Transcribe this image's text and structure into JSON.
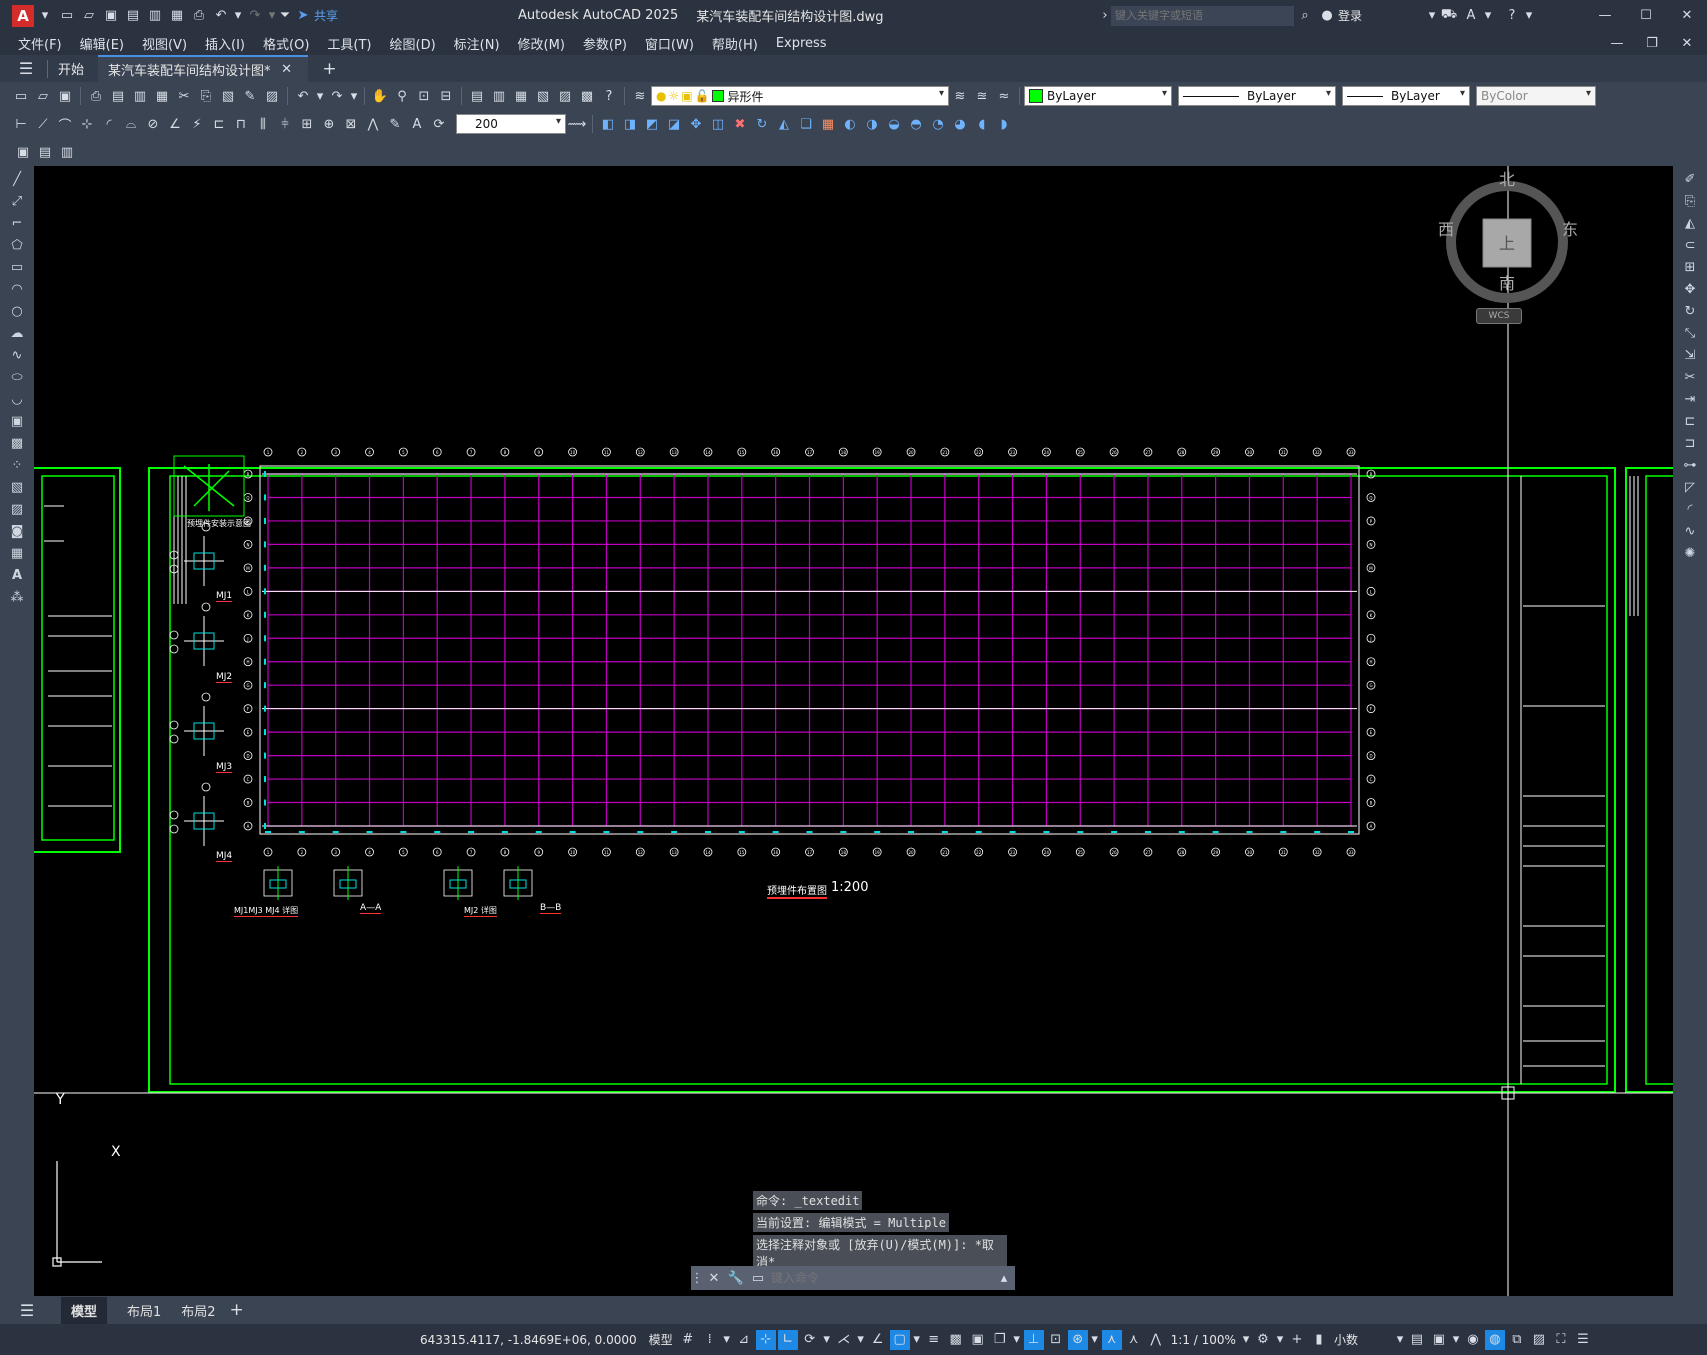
{
  "app": {
    "title": "Autodesk AutoCAD 2025",
    "document": "某汽车装配车间结构设计图.dwg",
    "share": "共享",
    "search_placeholder": "键入关键字或短语",
    "login": "登录"
  },
  "menu": [
    "文件(F)",
    "编辑(E)",
    "视图(V)",
    "插入(I)",
    "格式(O)",
    "工具(T)",
    "绘图(D)",
    "标注(N)",
    "修改(M)",
    "参数(P)",
    "窗口(W)",
    "帮助(H)",
    "Express"
  ],
  "tabs": {
    "start": "开始",
    "drawing": "某汽车装配车间结构设计图*"
  },
  "toolbar": {
    "layer": "异形件",
    "color": "ByLayer",
    "linetype": "ByLayer",
    "lineweight": "ByLayer",
    "plotstyle": "ByColor",
    "dimscale": "200"
  },
  "viewcube": {
    "north": "北",
    "south": "南",
    "east": "东",
    "west": "西",
    "top": "上",
    "wcs": "WCS"
  },
  "drawing": {
    "title": "预埋件布置图",
    "scale": "1:200",
    "detail_title": "预埋件安装示意图",
    "details": [
      "MJ1",
      "MJ2",
      "MJ3",
      "MJ4"
    ],
    "sections": [
      "MJ1MJ3 MJ4 详图",
      "A—A",
      "MJ2 详图",
      "B—B"
    ],
    "top_axes": [
      "1",
      "2",
      "3",
      "4",
      "5",
      "6",
      "7",
      "8",
      "9",
      "10",
      "11",
      "12",
      "13",
      "14",
      "15",
      "16",
      "17",
      "18",
      "19",
      "20",
      "21",
      "22",
      "23",
      "24",
      "25",
      "26",
      "27",
      "28",
      "29",
      "30",
      "31",
      "32",
      "33"
    ],
    "side_axes": [
      "R",
      "Q",
      "P",
      "N",
      "M",
      "L",
      "K",
      "J",
      "H",
      "G",
      "F",
      "E",
      "D",
      "C",
      "B",
      "A"
    ]
  },
  "command": {
    "lines": [
      "命令: _textedit",
      "当前设置: 编辑模式 = Multiple",
      "选择注释对象或 [放弃(U)/模式(M)]: *取消*"
    ],
    "placeholder": "键入命令"
  },
  "layouts": [
    "模型",
    "布局1",
    "布局2"
  ],
  "status": {
    "coords": "643315.4117, -1.8469E+06, 0.0000",
    "mode": "模型",
    "scale": "1:1 / 100%",
    "units": "小数"
  },
  "colors": {
    "accent": "#1e88e5",
    "green": "#00ff00",
    "magenta": "#c000c0",
    "cyan": "#00e0e0"
  }
}
